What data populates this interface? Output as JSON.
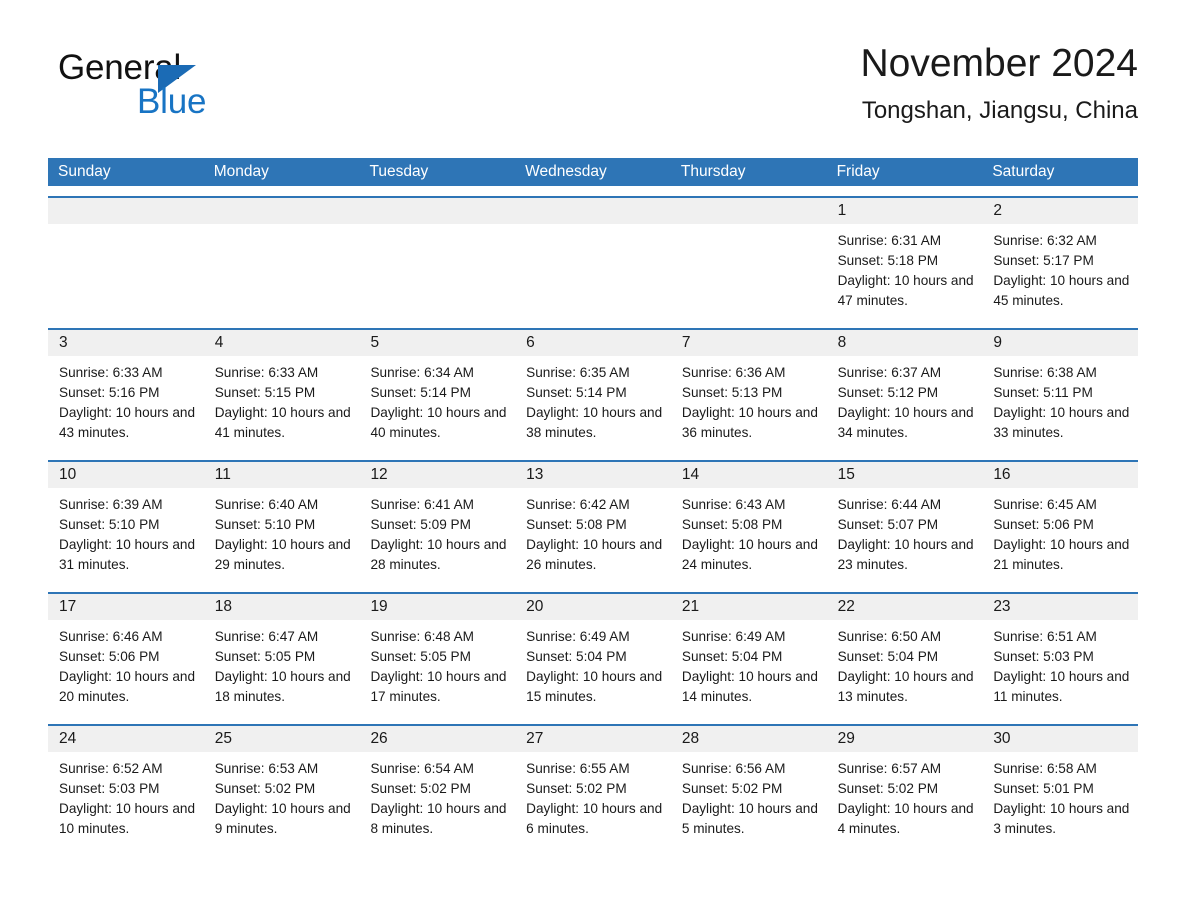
{
  "brand": {
    "word1": "General",
    "word2": "Blue",
    "triangle_color": "#1b6bb5",
    "word2_color": "#1874c4"
  },
  "header": {
    "title": "November 2024",
    "subtitle": "Tongshan, Jiangsu, China"
  },
  "theme": {
    "header_blue": "#2e75b6",
    "daynum_band": "#f0f0f0",
    "text": "#1a1a1a",
    "page_background": "#ffffff"
  },
  "labels": {
    "sunrise_prefix": "Sunrise: ",
    "sunset_prefix": "Sunset: ",
    "daylight_prefix": "Daylight: "
  },
  "weekdays": [
    "Sunday",
    "Monday",
    "Tuesday",
    "Wednesday",
    "Thursday",
    "Friday",
    "Saturday"
  ],
  "weeks": [
    {
      "days": [
        {
          "day": "",
          "sunrise": "",
          "sunset": "",
          "daylight": "",
          "empty": true
        },
        {
          "day": "",
          "sunrise": "",
          "sunset": "",
          "daylight": "",
          "empty": true
        },
        {
          "day": "",
          "sunrise": "",
          "sunset": "",
          "daylight": "",
          "empty": true
        },
        {
          "day": "",
          "sunrise": "",
          "sunset": "",
          "daylight": "",
          "empty": true
        },
        {
          "day": "",
          "sunrise": "",
          "sunset": "",
          "daylight": "",
          "empty": true
        },
        {
          "day": "1",
          "sunrise": "Sunrise: 6:31 AM",
          "sunset": "Sunset: 5:18 PM",
          "daylight": "Daylight: 10 hours and 47 minutes.",
          "empty": false
        },
        {
          "day": "2",
          "sunrise": "Sunrise: 6:32 AM",
          "sunset": "Sunset: 5:17 PM",
          "daylight": "Daylight: 10 hours and 45 minutes.",
          "empty": false
        }
      ]
    },
    {
      "days": [
        {
          "day": "3",
          "sunrise": "Sunrise: 6:33 AM",
          "sunset": "Sunset: 5:16 PM",
          "daylight": "Daylight: 10 hours and 43 minutes.",
          "empty": false
        },
        {
          "day": "4",
          "sunrise": "Sunrise: 6:33 AM",
          "sunset": "Sunset: 5:15 PM",
          "daylight": "Daylight: 10 hours and 41 minutes.",
          "empty": false
        },
        {
          "day": "5",
          "sunrise": "Sunrise: 6:34 AM",
          "sunset": "Sunset: 5:14 PM",
          "daylight": "Daylight: 10 hours and 40 minutes.",
          "empty": false
        },
        {
          "day": "6",
          "sunrise": "Sunrise: 6:35 AM",
          "sunset": "Sunset: 5:14 PM",
          "daylight": "Daylight: 10 hours and 38 minutes.",
          "empty": false
        },
        {
          "day": "7",
          "sunrise": "Sunrise: 6:36 AM",
          "sunset": "Sunset: 5:13 PM",
          "daylight": "Daylight: 10 hours and 36 minutes.",
          "empty": false
        },
        {
          "day": "8",
          "sunrise": "Sunrise: 6:37 AM",
          "sunset": "Sunset: 5:12 PM",
          "daylight": "Daylight: 10 hours and 34 minutes.",
          "empty": false
        },
        {
          "day": "9",
          "sunrise": "Sunrise: 6:38 AM",
          "sunset": "Sunset: 5:11 PM",
          "daylight": "Daylight: 10 hours and 33 minutes.",
          "empty": false
        }
      ]
    },
    {
      "days": [
        {
          "day": "10",
          "sunrise": "Sunrise: 6:39 AM",
          "sunset": "Sunset: 5:10 PM",
          "daylight": "Daylight: 10 hours and 31 minutes.",
          "empty": false
        },
        {
          "day": "11",
          "sunrise": "Sunrise: 6:40 AM",
          "sunset": "Sunset: 5:10 PM",
          "daylight": "Daylight: 10 hours and 29 minutes.",
          "empty": false
        },
        {
          "day": "12",
          "sunrise": "Sunrise: 6:41 AM",
          "sunset": "Sunset: 5:09 PM",
          "daylight": "Daylight: 10 hours and 28 minutes.",
          "empty": false
        },
        {
          "day": "13",
          "sunrise": "Sunrise: 6:42 AM",
          "sunset": "Sunset: 5:08 PM",
          "daylight": "Daylight: 10 hours and 26 minutes.",
          "empty": false
        },
        {
          "day": "14",
          "sunrise": "Sunrise: 6:43 AM",
          "sunset": "Sunset: 5:08 PM",
          "daylight": "Daylight: 10 hours and 24 minutes.",
          "empty": false
        },
        {
          "day": "15",
          "sunrise": "Sunrise: 6:44 AM",
          "sunset": "Sunset: 5:07 PM",
          "daylight": "Daylight: 10 hours and 23 minutes.",
          "empty": false
        },
        {
          "day": "16",
          "sunrise": "Sunrise: 6:45 AM",
          "sunset": "Sunset: 5:06 PM",
          "daylight": "Daylight: 10 hours and 21 minutes.",
          "empty": false
        }
      ]
    },
    {
      "days": [
        {
          "day": "17",
          "sunrise": "Sunrise: 6:46 AM",
          "sunset": "Sunset: 5:06 PM",
          "daylight": "Daylight: 10 hours and 20 minutes.",
          "empty": false
        },
        {
          "day": "18",
          "sunrise": "Sunrise: 6:47 AM",
          "sunset": "Sunset: 5:05 PM",
          "daylight": "Daylight: 10 hours and 18 minutes.",
          "empty": false
        },
        {
          "day": "19",
          "sunrise": "Sunrise: 6:48 AM",
          "sunset": "Sunset: 5:05 PM",
          "daylight": "Daylight: 10 hours and 17 minutes.",
          "empty": false
        },
        {
          "day": "20",
          "sunrise": "Sunrise: 6:49 AM",
          "sunset": "Sunset: 5:04 PM",
          "daylight": "Daylight: 10 hours and 15 minutes.",
          "empty": false
        },
        {
          "day": "21",
          "sunrise": "Sunrise: 6:49 AM",
          "sunset": "Sunset: 5:04 PM",
          "daylight": "Daylight: 10 hours and 14 minutes.",
          "empty": false
        },
        {
          "day": "22",
          "sunrise": "Sunrise: 6:50 AM",
          "sunset": "Sunset: 5:04 PM",
          "daylight": "Daylight: 10 hours and 13 minutes.",
          "empty": false
        },
        {
          "day": "23",
          "sunrise": "Sunrise: 6:51 AM",
          "sunset": "Sunset: 5:03 PM",
          "daylight": "Daylight: 10 hours and 11 minutes.",
          "empty": false
        }
      ]
    },
    {
      "days": [
        {
          "day": "24",
          "sunrise": "Sunrise: 6:52 AM",
          "sunset": "Sunset: 5:03 PM",
          "daylight": "Daylight: 10 hours and 10 minutes.",
          "empty": false
        },
        {
          "day": "25",
          "sunrise": "Sunrise: 6:53 AM",
          "sunset": "Sunset: 5:02 PM",
          "daylight": "Daylight: 10 hours and 9 minutes.",
          "empty": false
        },
        {
          "day": "26",
          "sunrise": "Sunrise: 6:54 AM",
          "sunset": "Sunset: 5:02 PM",
          "daylight": "Daylight: 10 hours and 8 minutes.",
          "empty": false
        },
        {
          "day": "27",
          "sunrise": "Sunrise: 6:55 AM",
          "sunset": "Sunset: 5:02 PM",
          "daylight": "Daylight: 10 hours and 6 minutes.",
          "empty": false
        },
        {
          "day": "28",
          "sunrise": "Sunrise: 6:56 AM",
          "sunset": "Sunset: 5:02 PM",
          "daylight": "Daylight: 10 hours and 5 minutes.",
          "empty": false
        },
        {
          "day": "29",
          "sunrise": "Sunrise: 6:57 AM",
          "sunset": "Sunset: 5:02 PM",
          "daylight": "Daylight: 10 hours and 4 minutes.",
          "empty": false
        },
        {
          "day": "30",
          "sunrise": "Sunrise: 6:58 AM",
          "sunset": "Sunset: 5:01 PM",
          "daylight": "Daylight: 10 hours and 3 minutes.",
          "empty": false
        }
      ]
    }
  ]
}
